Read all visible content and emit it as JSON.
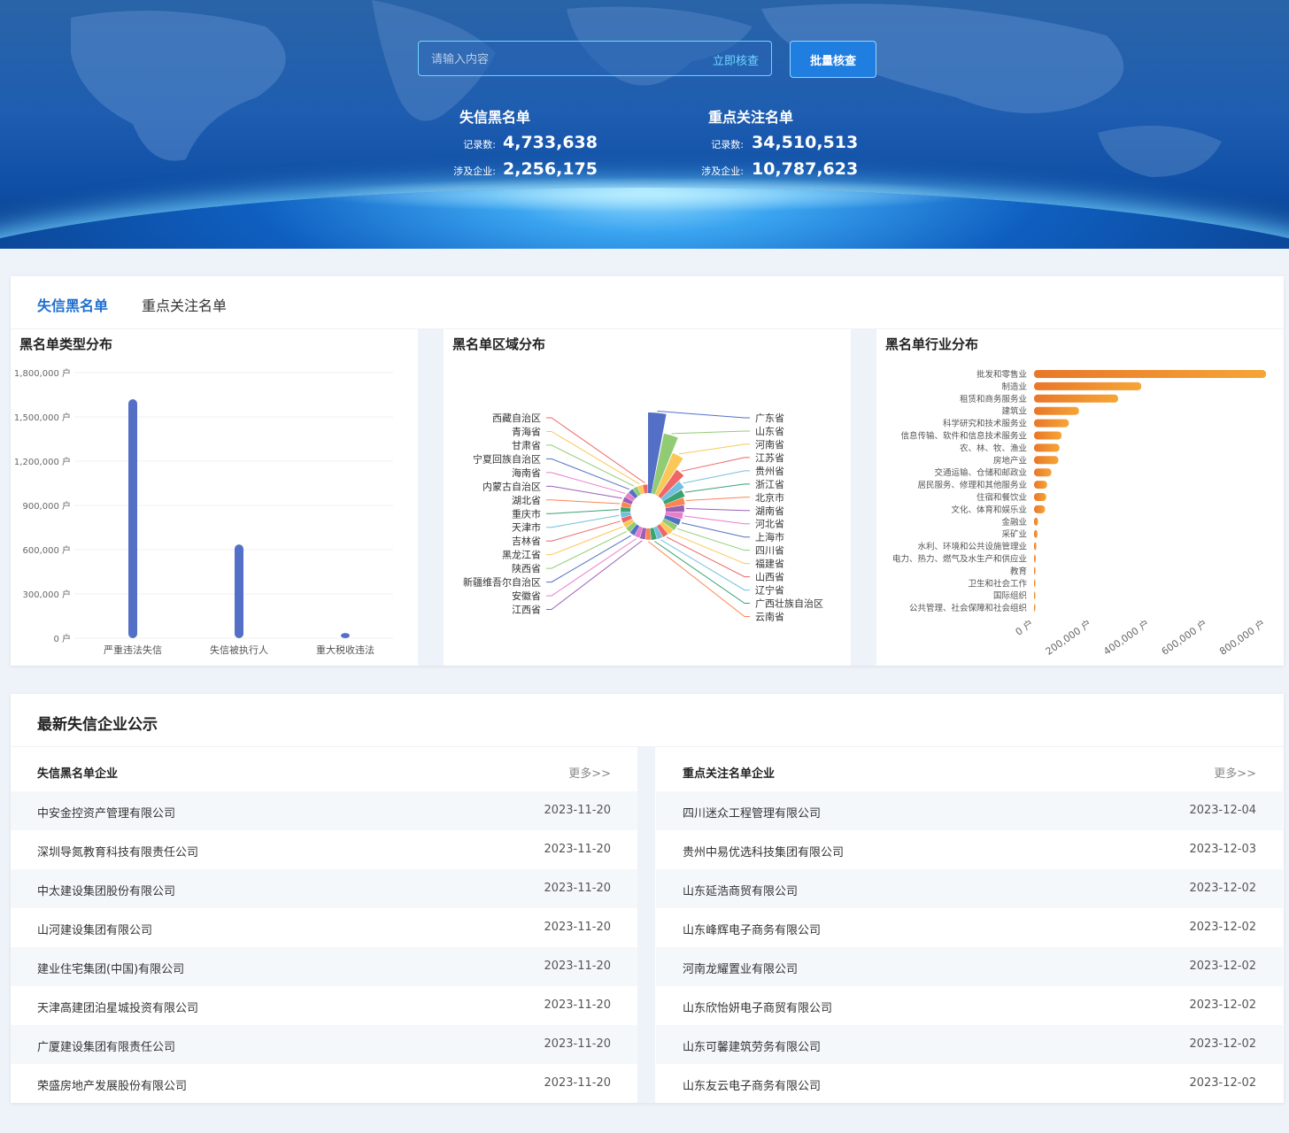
{
  "search": {
    "placeholder": "请输入内容",
    "go_label": "立即核查",
    "batch_label": "批量核查"
  },
  "stats": [
    {
      "title": "失信黑名单",
      "records_label": "记录数:",
      "records": "4,733,638",
      "companies_label": "涉及企业:",
      "companies": "2,256,175"
    },
    {
      "title": "重点关注名单",
      "records_label": "记录数:",
      "records": "34,510,513",
      "companies_label": "涉及企业:",
      "companies": "10,787,623"
    }
  ],
  "tabs": [
    {
      "label": "失信黑名单",
      "active": true
    },
    {
      "label": "重点关注名单",
      "active": false
    }
  ],
  "charts": {
    "type_title": "黑名单类型分布",
    "region_title": "黑名单区域分布",
    "industry_title": "黑名单行业分布"
  },
  "chart_data": [
    {
      "type": "bar",
      "title": "黑名单类型分布",
      "categories": [
        "严重违法失信",
        "失信被执行人",
        "重大税收违法"
      ],
      "values": [
        1620000,
        635000,
        35000
      ],
      "ylim": [
        0,
        1800000
      ],
      "yticks": [
        "0 户",
        "300,000 户",
        "600,000 户",
        "900,000 户",
        "1,200,000 户",
        "1,500,000 户",
        "1,800,000 户"
      ],
      "color": "#5470c6"
    },
    {
      "type": "pie",
      "title": "黑名单区域分布",
      "labels": [
        "广东省",
        "山东省",
        "河南省",
        "江苏省",
        "贵州省",
        "浙江省",
        "北京市",
        "湖南省",
        "河北省",
        "上海市",
        "四川省",
        "福建省",
        "山西省",
        "辽宁省",
        "广西壮族自治区",
        "云南省",
        "江西省",
        "安徽省",
        "新疆维吾尔自治区",
        "陕西省",
        "黑龙江省",
        "吉林省",
        "天津市",
        "重庆市",
        "湖北省",
        "内蒙古自治区",
        "海南省",
        "宁夏回族自治区",
        "甘肃省",
        "青海省",
        "西藏自治区"
      ],
      "values": [
        520000,
        420000,
        330000,
        250000,
        200000,
        175000,
        160000,
        150000,
        140000,
        130000,
        120000,
        110000,
        100000,
        95000,
        90000,
        85000,
        82000,
        80000,
        78000,
        76000,
        74000,
        72000,
        70000,
        68000,
        66000,
        64000,
        62000,
        60000,
        58000,
        56000,
        54000
      ],
      "colors": [
        "#5470c6",
        "#91cc75",
        "#fac858",
        "#ee6666",
        "#73c0de",
        "#3ba272",
        "#fc8452",
        "#9a60b4",
        "#ea7ccc"
      ]
    },
    {
      "type": "bar",
      "orientation": "horizontal",
      "title": "黑名单行业分布",
      "categories": [
        "批发和零售业",
        "制造业",
        "租赁和商务服务业",
        "建筑业",
        "科学研究和技术服务业",
        "信息传输、软件和信息技术服务业",
        "农、林、牧、渔业",
        "房地产业",
        "交通运输、仓储和邮政业",
        "居民服务、修理和其他服务业",
        "住宿和餐饮业",
        "文化、体育和娱乐业",
        "金融业",
        "采矿业",
        "水利、环境和公共设施管理业",
        "电力、热力、燃气及水生产和供应业",
        "教育",
        "卫生和社会工作",
        "国际组织",
        "公共管理、社会保障和社会组织"
      ],
      "values": [
        800000,
        370000,
        290000,
        155000,
        120000,
        95000,
        88000,
        84000,
        60000,
        45000,
        42000,
        38000,
        14000,
        12000,
        8000,
        6000,
        5000,
        3000,
        500,
        300
      ],
      "xlim": [
        0,
        800000
      ],
      "xticks": [
        "0 户",
        "200,000 户",
        "400,000 户",
        "600,000 户",
        "800,000 户"
      ],
      "color": "#f0892a"
    }
  ],
  "section_title": "最新失信企业公示",
  "lists": [
    {
      "heading": "失信黑名单企业",
      "more": "更多>>",
      "rows": [
        {
          "name": "中安金控资产管理有限公司",
          "date": "2023-11-20"
        },
        {
          "name": "深圳导氮教育科技有限责任公司",
          "date": "2023-11-20"
        },
        {
          "name": "中太建设集团股份有限公司",
          "date": "2023-11-20"
        },
        {
          "name": "山河建设集团有限公司",
          "date": "2023-11-20"
        },
        {
          "name": "建业住宅集团(中国)有限公司",
          "date": "2023-11-20"
        },
        {
          "name": "天津高建团泊星城投资有限公司",
          "date": "2023-11-20"
        },
        {
          "name": "广厦建设集团有限责任公司",
          "date": "2023-11-20"
        },
        {
          "name": "荣盛房地产发展股份有限公司",
          "date": "2023-11-20"
        }
      ]
    },
    {
      "heading": "重点关注名单企业",
      "more": "更多>>",
      "rows": [
        {
          "name": "四川迷众工程管理有限公司",
          "date": "2023-12-04"
        },
        {
          "name": "贵州中易优选科技集团有限公司",
          "date": "2023-12-03"
        },
        {
          "name": "山东延浩商贸有限公司",
          "date": "2023-12-02"
        },
        {
          "name": "山东峰辉电子商务有限公司",
          "date": "2023-12-02"
        },
        {
          "name": "河南龙耀置业有限公司",
          "date": "2023-12-02"
        },
        {
          "name": "山东欣怡妍电子商贸有限公司",
          "date": "2023-12-02"
        },
        {
          "name": "山东可馨建筑劳务有限公司",
          "date": "2023-12-02"
        },
        {
          "name": "山东友云电子商务有限公司",
          "date": "2023-12-02"
        }
      ]
    }
  ]
}
